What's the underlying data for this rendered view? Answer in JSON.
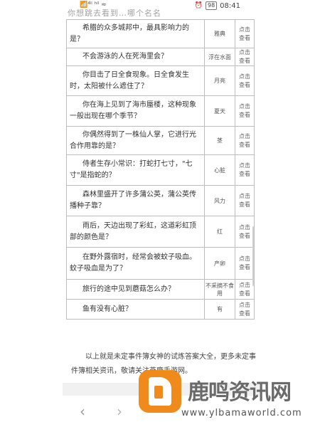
{
  "status_bar": {
    "truncated_text": "你想跳去看到…哪个名名",
    "left_icons": "📶⁴ˡˡ ʰˡˡ ≈",
    "battery": "98",
    "time": "08:41"
  },
  "table": {
    "rows": [
      {
        "question": "希腊的众多城邦中，最具影响力的是？",
        "answer": "雅典",
        "link": [
          "点击",
          "查看"
        ]
      },
      {
        "question": "不会游泳的人在死海里会？",
        "answer": "浮在水面",
        "link": [
          "点击",
          "查看"
        ]
      },
      {
        "question": "你目击了日全食现象。日全食发生时，太阳被什么遮住了？",
        "answer": "月亮",
        "link": [
          "点击",
          "查看"
        ]
      },
      {
        "question": "你在海上见到了海市蜃楼，这种现象一般出现在哪个季节？",
        "answer": "夏天",
        "link": [
          "点击",
          "查看"
        ]
      },
      {
        "question": "你偶然得到了一株仙人掌，它进行光合作用靠的是？",
        "answer": "茎",
        "link": [
          "点击",
          "查看"
        ]
      },
      {
        "question": "侍者生存小常识：打蛇打七寸，\"七寸\"是指蛇的？",
        "answer": "心脏",
        "link": [
          "点击",
          "查看"
        ]
      },
      {
        "question": "森林里盛开了许多蒲公英，蒲公英传播种子靠？",
        "answer": "风力",
        "link": [
          "点击",
          "查看"
        ]
      },
      {
        "question": "雨后，天边出现了彩虹，这道彩虹顶部的颜色是？",
        "answer": "红",
        "link": [
          "点击",
          "查看"
        ]
      },
      {
        "question": "在野外露宿时，经常会被蚊子吸血。蚊子吸血是为了？",
        "answer": "产卵",
        "link": [
          "点击",
          "查看"
        ]
      },
      {
        "question": "旅行的途中见到蘑菇怎么办？",
        "answer": "不采摘不食用",
        "link": [
          "点击",
          "查看"
        ]
      },
      {
        "question": "鱼有没有心脏？",
        "answer": "有",
        "link": [
          "点击",
          "查看"
        ]
      }
    ]
  },
  "summary": "以上就是未定事件簿女神的试炼答案大全，更多未定事件簿相关资讯，敬请关注燕鹿手游网。",
  "nav": {
    "back": "‹",
    "forward": "›"
  },
  "watermark": {
    "title": "鹿鸣资讯网",
    "url": "www.ylbamaworld.com",
    "color": "#f08a1a"
  }
}
